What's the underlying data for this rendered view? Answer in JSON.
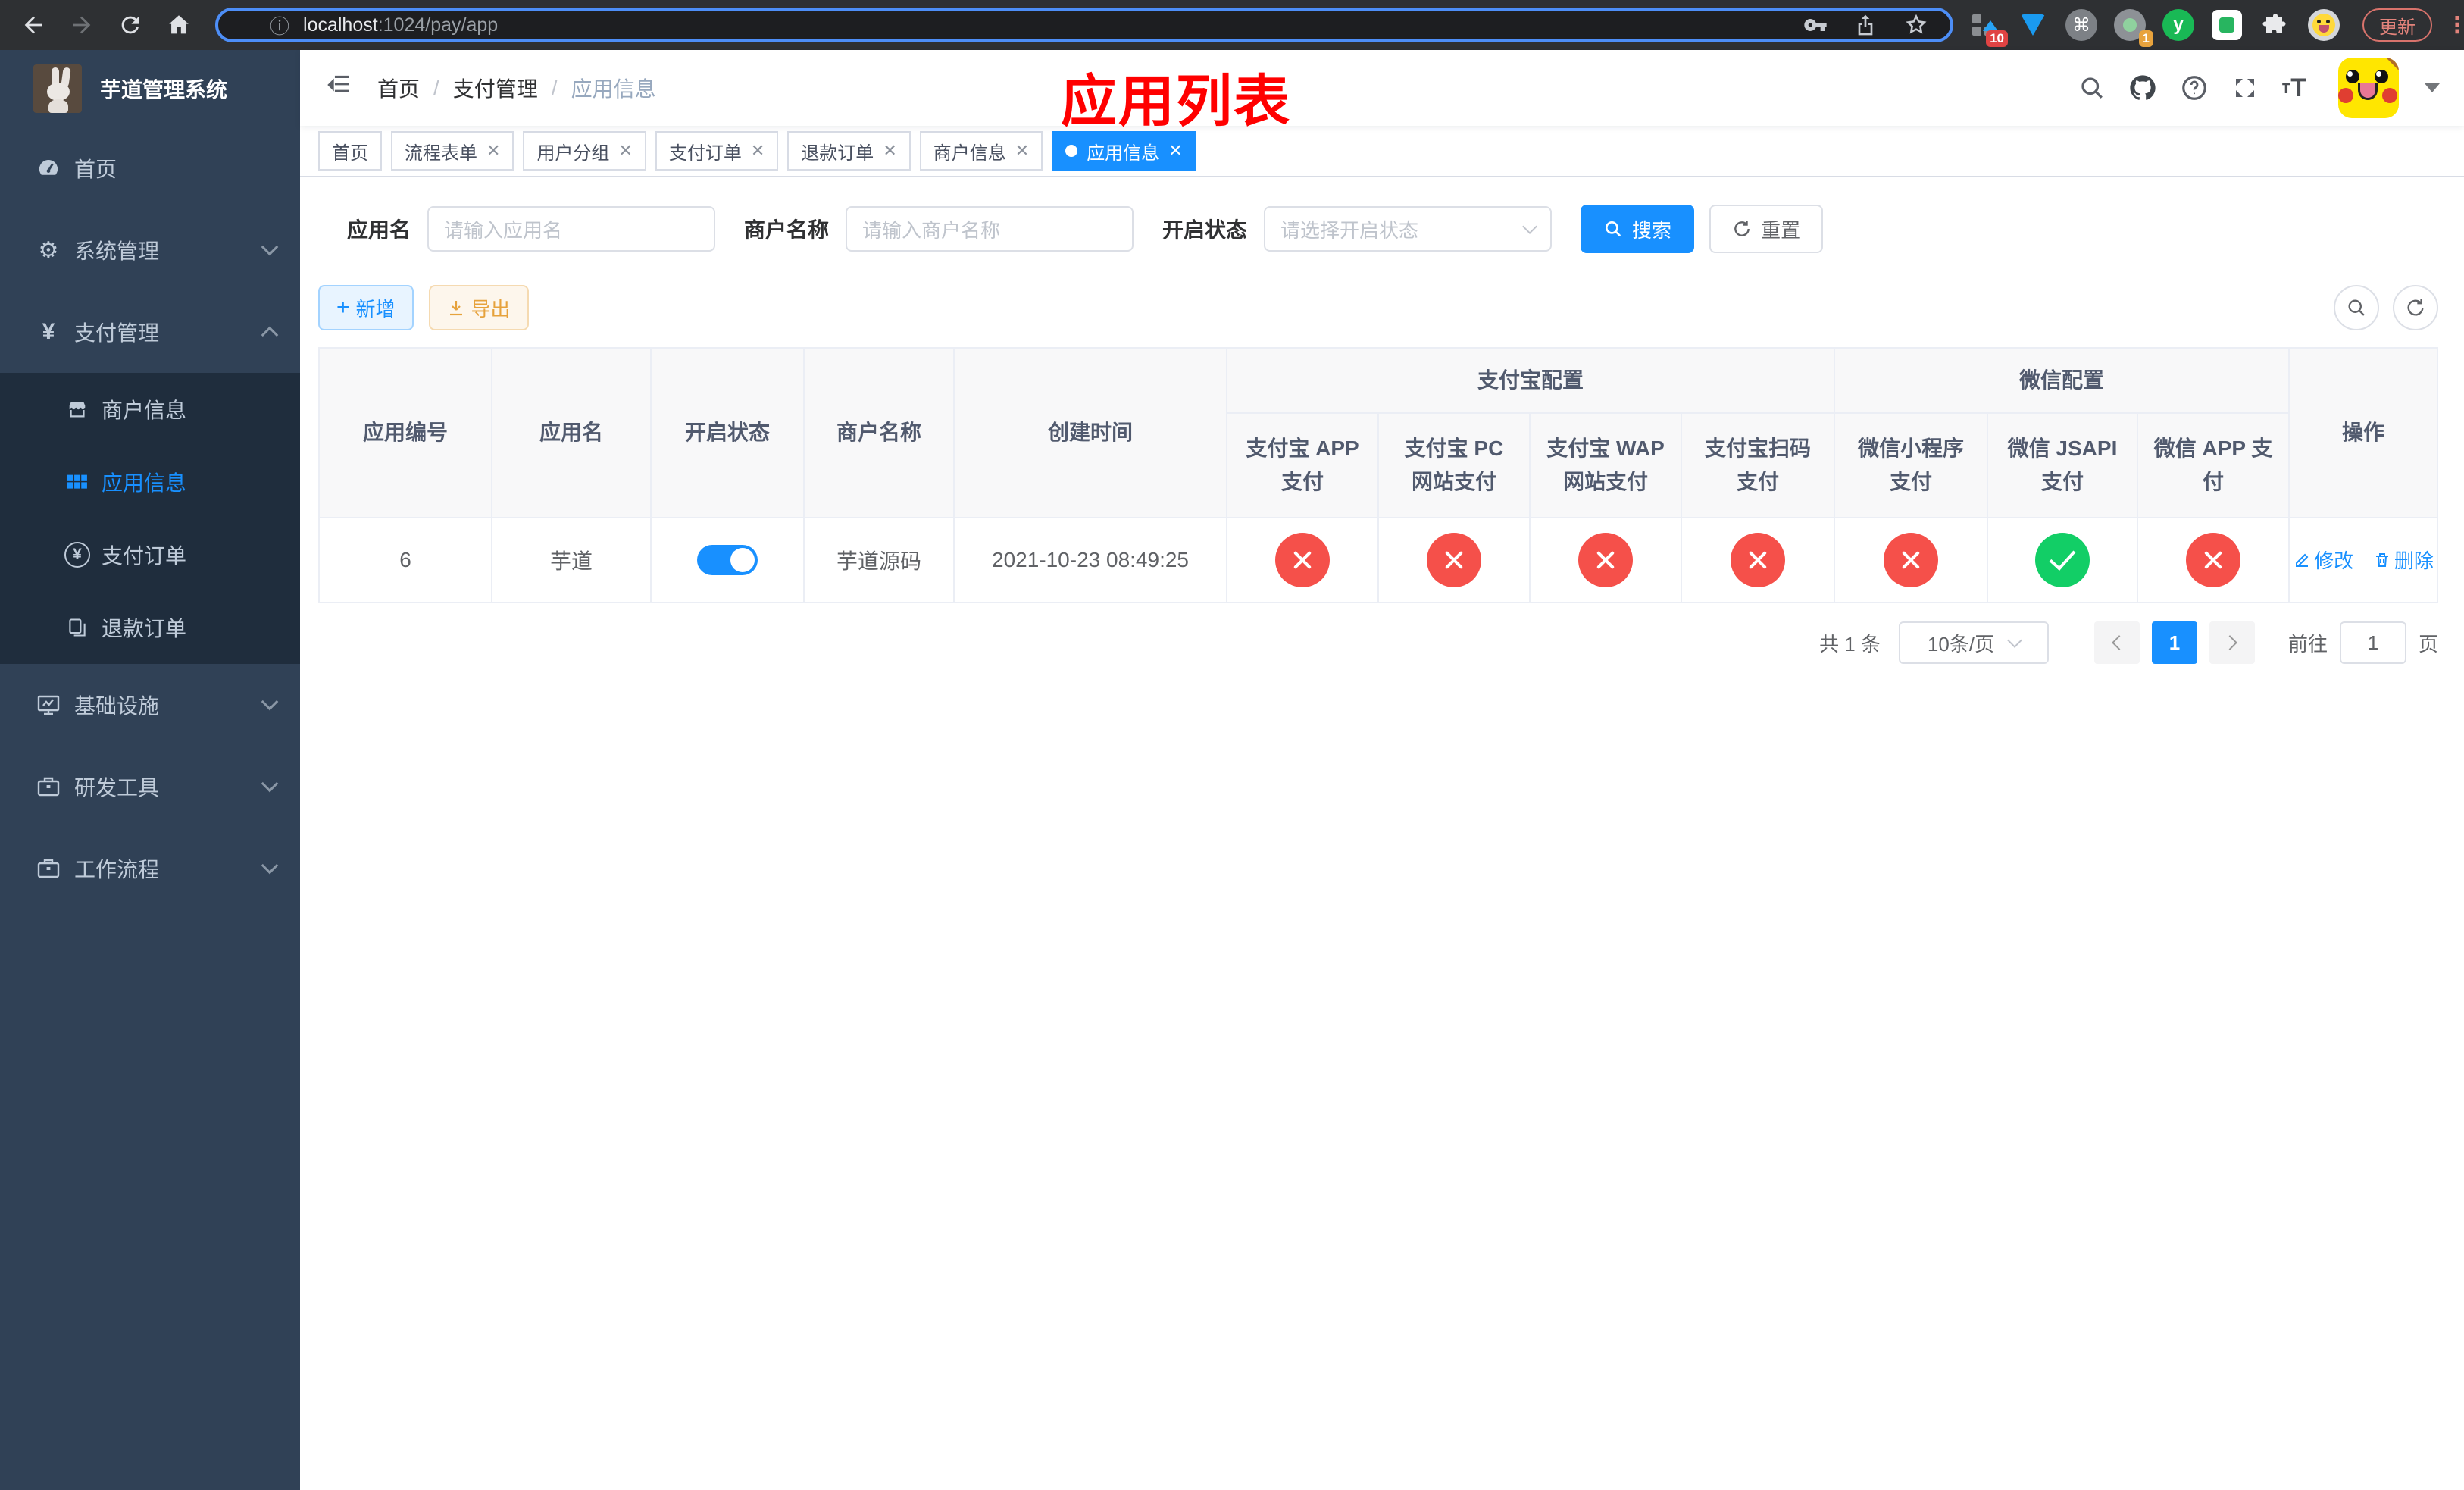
{
  "browser": {
    "url_host": "localhost",
    "url_rest": ":1024/pay/app",
    "update_label": "更新",
    "ext_badge_10": "10",
    "ext_badge_1": "1",
    "ext_y_label": "y"
  },
  "sidebar": {
    "title": "芋道管理系统",
    "items": [
      {
        "label": "首页"
      },
      {
        "label": "系统管理"
      },
      {
        "label": "支付管理"
      },
      {
        "label": "基础设施"
      },
      {
        "label": "研发工具"
      },
      {
        "label": "工作流程"
      }
    ],
    "pay_children": [
      {
        "label": "商户信息"
      },
      {
        "label": "应用信息",
        "active": true
      },
      {
        "label": "支付订单"
      },
      {
        "label": "退款订单"
      }
    ]
  },
  "navbar": {
    "breadcrumb": [
      "首页",
      "支付管理",
      "应用信息"
    ],
    "overlay_title": "应用列表"
  },
  "tabs": [
    {
      "label": "首页",
      "closable": false
    },
    {
      "label": "流程表单",
      "closable": true
    },
    {
      "label": "用户分组",
      "closable": true
    },
    {
      "label": "支付订单",
      "closable": true
    },
    {
      "label": "退款订单",
      "closable": true
    },
    {
      "label": "商户信息",
      "closable": true
    },
    {
      "label": "应用信息",
      "closable": true,
      "active": true
    }
  ],
  "filter": {
    "app_name_label": "应用名",
    "app_name_placeholder": "请输入应用名",
    "merchant_label": "商户名称",
    "merchant_placeholder": "请输入商户名称",
    "status_label": "开启状态",
    "status_placeholder": "请选择开启状态",
    "search_label": "搜索",
    "reset_label": "重置"
  },
  "toolbar": {
    "add_label": "新增",
    "export_label": "导出"
  },
  "table": {
    "columns": [
      "应用编号",
      "应用名",
      "开启状态",
      "商户名称",
      "创建时间"
    ],
    "group_alipay": "支付宝配置",
    "group_wechat": "微信配置",
    "sub_columns": [
      "支付宝 APP 支付",
      "支付宝 PC 网站支付",
      "支付宝 WAP 网站支付",
      "支付宝扫码支付",
      "微信小程序支付",
      "微信 JSAPI 支付",
      "微信 APP 支付"
    ],
    "op_column": "操作",
    "row": {
      "id": "6",
      "name": "芋道",
      "status_on": true,
      "merchant": "芋道源码",
      "created": "2021-10-23 08:49:25",
      "pay_status": [
        false,
        false,
        false,
        false,
        false,
        true,
        false
      ],
      "edit_label": "修改",
      "delete_label": "删除"
    }
  },
  "pagination": {
    "total": "共 1 条",
    "page_size": "10条/页",
    "current_page": "1",
    "goto_label": "前往",
    "goto_value": "1",
    "unit_label": "页"
  }
}
